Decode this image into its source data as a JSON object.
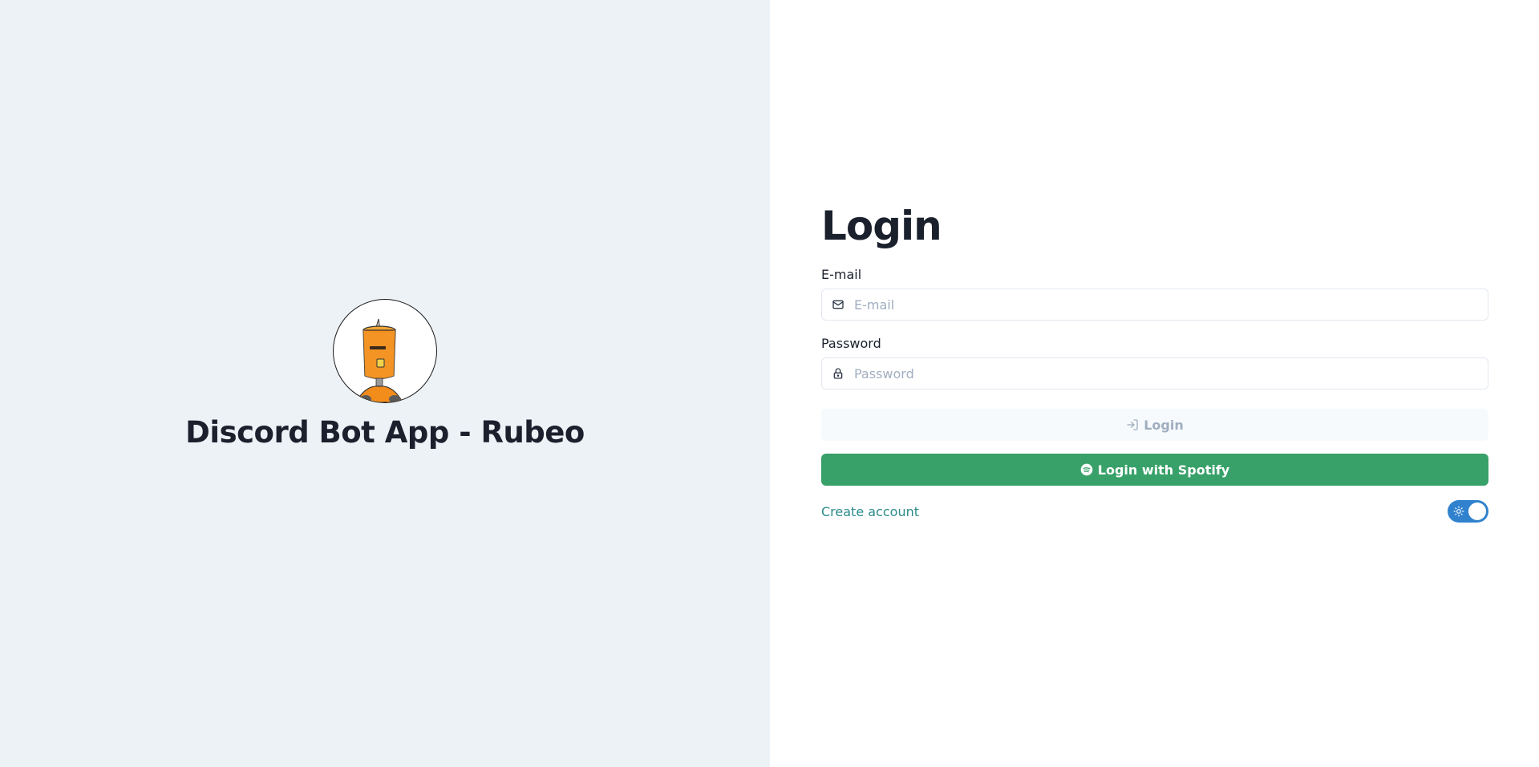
{
  "brand": {
    "title": "Discord Bot App - Rubeo",
    "avatar_icon": "robot-avatar"
  },
  "login": {
    "title": "Login",
    "email": {
      "label": "E-mail",
      "placeholder": "E-mail",
      "value": "",
      "icon": "mail-icon"
    },
    "password": {
      "label": "Password",
      "placeholder": "Password",
      "value": "",
      "icon": "lock-icon"
    },
    "login_button": {
      "label": "Login",
      "icon": "login-arrow-icon"
    },
    "spotify_button": {
      "label": "Login with Spotify",
      "icon": "spotify-icon"
    },
    "create_account_link": "Create account",
    "theme_toggle": {
      "icon": "sun-icon",
      "state": "on"
    }
  },
  "colors": {
    "left_bg": "#edf2f7",
    "spotify_green": "#38a169",
    "link_teal": "#2c8b8b",
    "toggle_blue": "#3182ce",
    "disabled_button_bg": "#f7fafc",
    "disabled_button_text": "#a0aec0"
  }
}
